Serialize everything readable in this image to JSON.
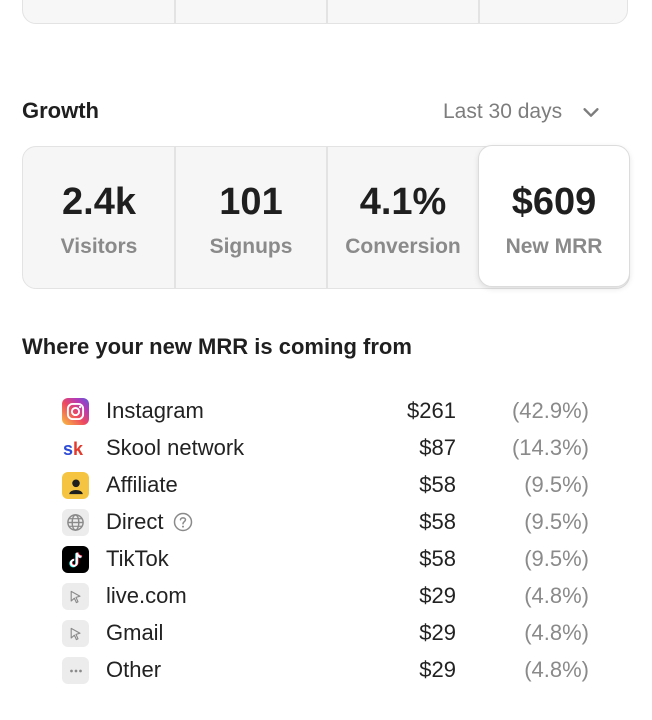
{
  "growth": {
    "title": "Growth",
    "range_label": "Last 30 days"
  },
  "stats": [
    {
      "value": "2.4k",
      "label": "Visitors"
    },
    {
      "value": "101",
      "label": "Signups"
    },
    {
      "value": "4.1%",
      "label": "Conversion"
    },
    {
      "value": "$609",
      "label": "New MRR"
    }
  ],
  "sources": {
    "title": "Where your new MRR is coming from",
    "items": [
      {
        "name": "Instagram",
        "amount": "$261",
        "pct": "(42.9%)",
        "icon": "instagram-icon"
      },
      {
        "name": "Skool network",
        "amount": "$87",
        "pct": "(14.3%)",
        "icon": "skool-icon",
        "icon_text": "sk"
      },
      {
        "name": "Affiliate",
        "amount": "$58",
        "pct": "(9.5%)",
        "icon": "affiliate-icon"
      },
      {
        "name": "Direct",
        "amount": "$58",
        "pct": "(9.5%)",
        "icon": "globe-icon"
      },
      {
        "name": "TikTok",
        "amount": "$58",
        "pct": "(9.5%)",
        "icon": "tiktok-icon"
      },
      {
        "name": "live.com",
        "amount": "$29",
        "pct": "(4.8%)",
        "icon": "cursor-icon"
      },
      {
        "name": "Gmail",
        "amount": "$29",
        "pct": "(4.8%)",
        "icon": "cursor-icon"
      },
      {
        "name": "Other",
        "amount": "$29",
        "pct": "(4.8%)",
        "icon": "more-icon"
      }
    ]
  },
  "colors": {
    "card_bg": "#f6f6f6",
    "border": "#e3e3e3",
    "muted": "#8a8a8a",
    "skool_blue": "#2e4bd6",
    "skool_red": "#e23b2e",
    "affiliate_yellow": "#f5c542"
  }
}
